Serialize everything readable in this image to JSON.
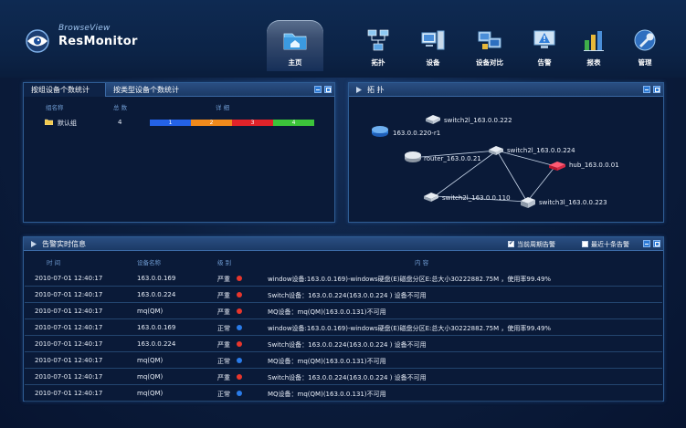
{
  "app": {
    "brand_top": "BrowseView",
    "brand_main": "ResMonitor"
  },
  "nav": [
    {
      "label": "主页",
      "icon": "folder-home-icon",
      "active": true
    },
    {
      "label": "拓扑",
      "icon": "topology-icon"
    },
    {
      "label": "设备",
      "icon": "device-icon"
    },
    {
      "label": "设备对比",
      "icon": "device-compare-icon"
    },
    {
      "label": "告警",
      "icon": "alarm-icon"
    },
    {
      "label": "报表",
      "icon": "report-icon"
    },
    {
      "label": "管理",
      "icon": "manage-icon"
    }
  ],
  "stats": {
    "tabs": [
      "按组设备个数统计",
      "按类型设备个数统计"
    ],
    "columns": {
      "group": "组名称",
      "total": "总 数",
      "detail": "详 细"
    },
    "row": {
      "group": "默认组",
      "total": "4"
    },
    "segments": [
      {
        "label": "1",
        "color": "#2462e6"
      },
      {
        "label": "2",
        "color": "#f08a1c"
      },
      {
        "label": "3",
        "color": "#e0232a"
      },
      {
        "label": "4",
        "color": "#3cc43a"
      }
    ]
  },
  "topology": {
    "title": "拓 扑",
    "nodes": [
      {
        "name": "switch2l_163.0.0.222",
        "icon": "switch-icon"
      },
      {
        "name": "163.0.0.220-r1",
        "icon": "router-blue-icon"
      },
      {
        "name": "router_163.0.0.21",
        "icon": "router-icon"
      },
      {
        "name": "switch2l_163.0.0.224",
        "icon": "switch-icon"
      },
      {
        "name": "hub_163.0.0.01",
        "icon": "hub-icon"
      },
      {
        "name": "switch2l_163.0.0.110",
        "icon": "switch-icon"
      },
      {
        "name": "switch3l_163.0.0.223",
        "icon": "switch3l-icon"
      }
    ]
  },
  "alarms": {
    "title": "告警实时信息",
    "opt_current": "当前周期告警",
    "opt_recent": "最近十条告警",
    "current_checked": true,
    "recent_checked": false,
    "columns": {
      "time": "时 间",
      "device": "设备名称",
      "level": "级 别",
      "content": "内 容"
    },
    "rows": [
      {
        "time": "2010-07-01 12:40:17",
        "device": "163.0.0.169",
        "level": "严重",
        "status": "critical",
        "content": "window设备:163.0.0.169)-windows硬盘(E)磁盘分区E:总大小30222882.75M ，使用率99.49%"
      },
      {
        "time": "2010-07-01 12:40:17",
        "device": "163.0.0.224",
        "level": "严重",
        "status": "critical",
        "content": "Switch设备：163.0.0.224(163.0.0.224 ) 设备不可用"
      },
      {
        "time": "2010-07-01 12:40:17",
        "device": "mq(QM)",
        "level": "严重",
        "status": "critical",
        "content": "MQ设备：mq(QM)(163.0.0.131)不可用"
      },
      {
        "time": "2010-07-01 12:40:17",
        "device": "163.0.0.169",
        "level": "正常",
        "status": "normal",
        "content": "window设备:163.0.0.169)-windows硬盘(E)磁盘分区E:总大小30222882.75M ，使用率99.49%"
      },
      {
        "time": "2010-07-01 12:40:17",
        "device": "163.0.0.224",
        "level": "严重",
        "status": "critical",
        "content": "Switch设备：163.0.0.224(163.0.0.224 ) 设备不可用"
      },
      {
        "time": "2010-07-01 12:40:17",
        "device": "mq(QM)",
        "level": "正常",
        "status": "normal",
        "content": "MQ设备：mq(QM)(163.0.0.131)不可用"
      },
      {
        "time": "2010-07-01 12:40:17",
        "device": "mq(QM)",
        "level": "严重",
        "status": "critical",
        "content": "Switch设备：163.0.0.224(163.0.0.224 ) 设备不可用"
      },
      {
        "time": "2010-07-01 12:40:17",
        "device": "mq(QM)",
        "level": "正常",
        "status": "normal",
        "content": "MQ设备：mq(QM)(163.0.0.131)不可用"
      }
    ]
  },
  "colors": {
    "critical": "#e8362c",
    "normal": "#2a7be8",
    "accent": "#2e7bd6"
  }
}
